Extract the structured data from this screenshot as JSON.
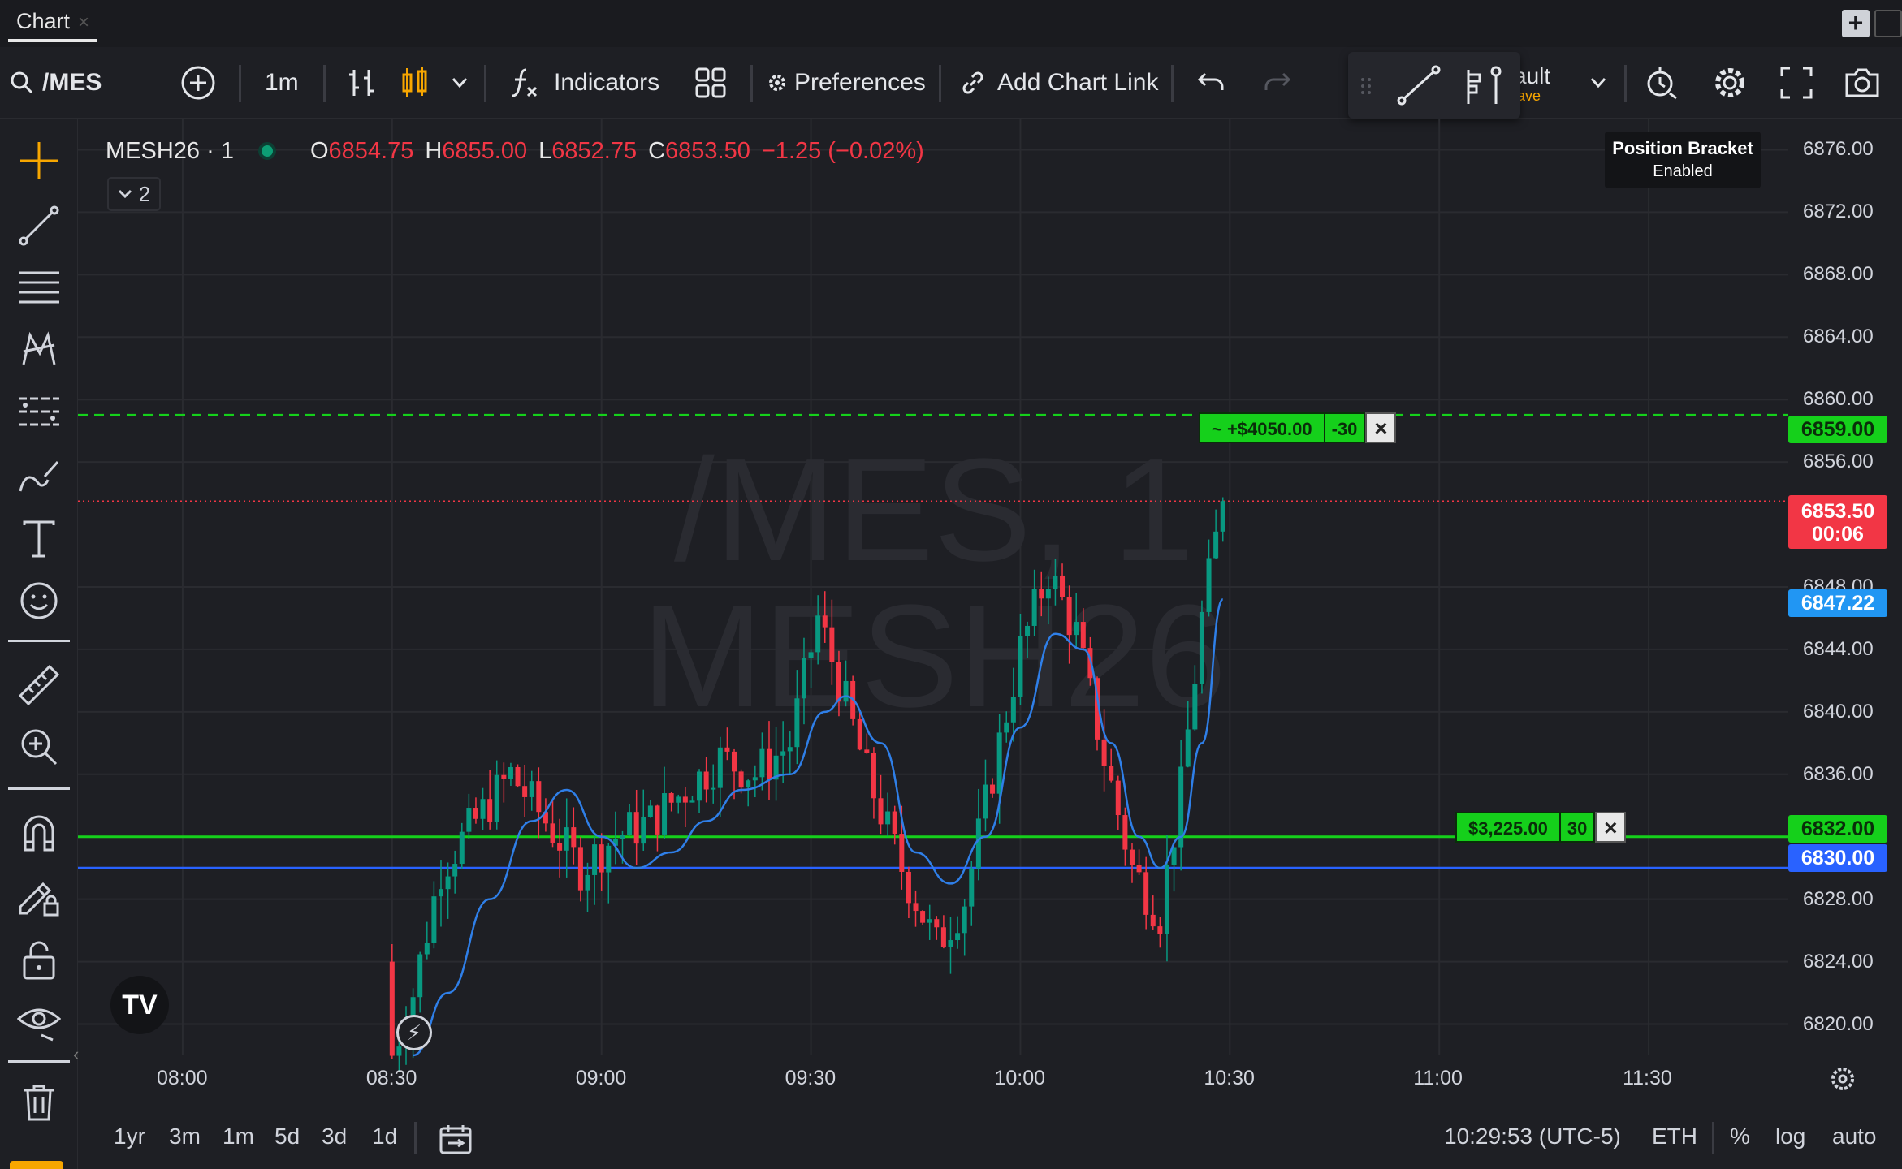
{
  "tabs": [
    {
      "label": "Chart",
      "close": "×"
    }
  ],
  "toolbar": {
    "symbol": "/MES",
    "interval": "1m",
    "indicators_label": "Indicators",
    "preferences_label": "Preferences",
    "add_chart_link_label": "Add Chart Link",
    "layout_name_partial": "ault",
    "layout_save_partial": "ave"
  },
  "legend": {
    "symbol": "MESH26 · 1",
    "open_label": "O",
    "open": "6854.75",
    "high_label": "H",
    "high": "6855.00",
    "low_label": "L",
    "low": "6852.75",
    "close_label": "C",
    "close": "6853.50",
    "change": "−1.25 (−0.02%)",
    "collapsed_count": "2"
  },
  "tooltip": {
    "title": "Position Bracket",
    "status": "Enabled"
  },
  "watermark": {
    "line1": "/MES, 1",
    "line2": "MESH26"
  },
  "price_axis": {
    "ticks": [
      "6876.00",
      "6872.00",
      "6868.00",
      "6864.00",
      "6860.00",
      "6856.00",
      "6848.00",
      "6844.00",
      "6840.00",
      "6836.00",
      "6828.00",
      "6824.00",
      "6820.00"
    ],
    "badges": {
      "take_profit": "6859.00",
      "last_price": "6853.50",
      "countdown": "00:06",
      "ma": "6847.22",
      "stop": "6832.00",
      "position": "6830.00"
    }
  },
  "orders": {
    "take_profit": {
      "label": "~ +$4050.00",
      "qty": "-30",
      "close": "×"
    },
    "position": {
      "label": "$3,225.00",
      "qty": "30",
      "close": "×"
    }
  },
  "time_axis": [
    "08:00",
    "08:30",
    "09:00",
    "09:30",
    "10:00",
    "10:30",
    "11:00",
    "11:30"
  ],
  "bottombar": {
    "ranges": [
      "1yr",
      "3m",
      "1m",
      "5d",
      "3d",
      "1d"
    ],
    "clock": "10:29:53 (UTC-5)",
    "session": "ETH",
    "percent": "%",
    "log": "log",
    "auto": "auto"
  },
  "colors": {
    "up": "#089981",
    "down": "#f23645",
    "ma": "#2962ff",
    "bg": "#1e1f24",
    "take_profit": "#15d01b",
    "position": "#2962ff",
    "last": "#f23645",
    "ma_badge": "#2196f3"
  },
  "chart_data": {
    "type": "candlestick",
    "ylim": [
      6818,
      6878
    ],
    "x_range": [
      "07:45",
      "11:50"
    ],
    "levels": {
      "take_profit": 6859.0,
      "last": 6853.5,
      "stop": 6832.0,
      "position": 6830.0
    },
    "ma_points": [
      [
        "08:33",
        6818
      ],
      [
        "08:38",
        6822
      ],
      [
        "08:44",
        6828
      ],
      [
        "08:50",
        6833
      ],
      [
        "08:55",
        6835
      ],
      [
        "09:00",
        6832
      ],
      [
        "09:05",
        6830
      ],
      [
        "09:10",
        6831
      ],
      [
        "09:15",
        6833
      ],
      [
        "09:20",
        6835
      ],
      [
        "09:27",
        6836
      ],
      [
        "09:32",
        6840
      ],
      [
        "09:35",
        6841
      ],
      [
        "09:40",
        6838
      ],
      [
        "09:45",
        6831
      ],
      [
        "09:50",
        6829
      ],
      [
        "09:55",
        6832
      ],
      [
        "10:00",
        6839
      ],
      [
        "10:05",
        6845
      ],
      [
        "10:09",
        6844
      ],
      [
        "10:13",
        6838
      ],
      [
        "10:17",
        6832
      ],
      [
        "10:20",
        6830
      ],
      [
        "10:23",
        6832
      ],
      [
        "10:26",
        6838
      ],
      [
        "10:29",
        6847.2
      ]
    ],
    "anchors": [
      [
        "08:30",
        6818
      ],
      [
        "08:33",
        6822
      ],
      [
        "08:37",
        6830
      ],
      [
        "08:42",
        6833
      ],
      [
        "08:47",
        6836
      ],
      [
        "08:52",
        6833
      ],
      [
        "08:57",
        6830
      ],
      [
        "09:02",
        6832
      ],
      [
        "09:07",
        6833
      ],
      [
        "09:12",
        6835
      ],
      [
        "09:17",
        6837
      ],
      [
        "09:22",
        6836
      ],
      [
        "09:27",
        6838
      ],
      [
        "09:31",
        6846
      ],
      [
        "09:34",
        6842
      ],
      [
        "09:38",
        6836
      ],
      [
        "09:43",
        6830
      ],
      [
        "09:48",
        6825
      ],
      [
        "09:52",
        6828
      ],
      [
        "09:56",
        6836
      ],
      [
        "10:00",
        6844
      ],
      [
        "10:04",
        6849
      ],
      [
        "10:08",
        6845
      ],
      [
        "10:12",
        6837
      ],
      [
        "10:16",
        6830
      ],
      [
        "10:20",
        6827
      ],
      [
        "10:23",
        6835
      ],
      [
        "10:26",
        6846
      ],
      [
        "10:29",
        6853.5
      ]
    ]
  }
}
